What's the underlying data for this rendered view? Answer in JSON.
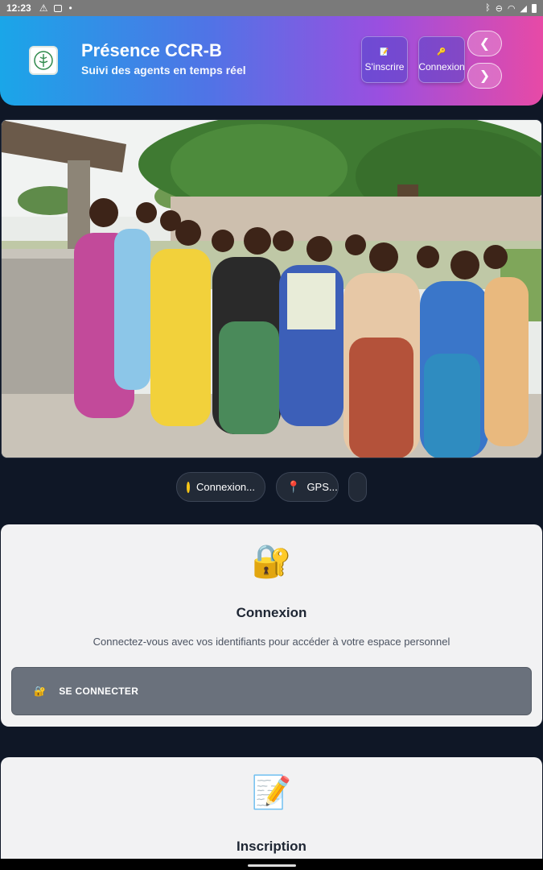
{
  "status_bar": {
    "time": "12:23"
  },
  "header": {
    "title": "Présence CCR-B",
    "subtitle": "Suivi des agents en temps réel",
    "register_button": "S'inscrire",
    "login_button": "Connexion",
    "prev_arrow": "❮",
    "next_arrow": "❯"
  },
  "chips": {
    "connection": "Connexion...",
    "gps": "GPS..."
  },
  "login_card": {
    "emoji": "🔐",
    "title": "Connexion",
    "description": "Connectez-vous avec vos identifiants pour accéder à votre espace personnel",
    "button_icon": "🔐",
    "button_label": "SE CONNECTER"
  },
  "register_card": {
    "emoji": "📝",
    "title": "Inscription"
  },
  "colors": {
    "header_gradient_start": "#1aa6e8",
    "header_gradient_end": "#e74aa6",
    "background": "#0f1726",
    "card": "#f2f2f3",
    "button": "#6a717c"
  }
}
